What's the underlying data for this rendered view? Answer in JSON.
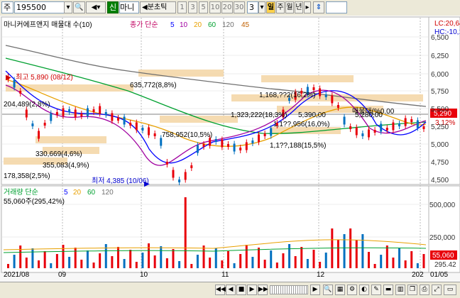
{
  "toolbar": {
    "market_label": "주",
    "code_value": "195500",
    "credit_badge": "신",
    "stock_name": "마니",
    "mode_label": "분초틱",
    "periods": [
      "1",
      "3",
      "5",
      "10",
      "20",
      "30"
    ],
    "count_value": "3",
    "scale_active": "일",
    "scales": [
      "주",
      "월",
      "년"
    ]
  },
  "chart": {
    "title": "마니커에프앤지 매물대 수(10)",
    "ma_label": "종가 단순",
    "ma_periods": [
      "5",
      "10",
      "20",
      "60",
      "120",
      "45"
    ],
    "lc": "LC:20,64",
    "hc": "HC:-10,1",
    "y_ticks": [
      "6,500",
      "6,250",
      "6,000",
      "5,750",
      "5,500",
      "5,250",
      "5,000",
      "4,750",
      "4,500"
    ],
    "last_price": "5,290",
    "change_pct": "3.12%",
    "high_note": "최고 5,890 (08/12)",
    "low_note": "최저 4,385 (10/06)",
    "current_line_label": "매물대(%0.00",
    "zones": [
      "635,772(8,8%)",
      "1,168,??2(16,2%)",
      "204,489(2,8%)",
      "1,323,222(18,3%)",
      "5,390,00",
      "5,280,00",
      "1,1??,956(16,0%)",
      "758,952(10,5%)",
      "1,1??,188(15,5%)",
      "330,669(4,6%)",
      "355,083(4,9%)",
      "178,358(2,5%)"
    ],
    "volume": {
      "title": "거래량 단순",
      "ma_periods": [
        "5",
        "20",
        "60",
        "120"
      ],
      "current": "55,060주(295,42%)",
      "y_ticks": [
        "500,000",
        "250,000"
      ],
      "last_value": "55,060",
      "last_pct": "295.42"
    },
    "x_labels": [
      "2021/08",
      "09",
      "10",
      "11",
      "12",
      "202",
      "01/05"
    ]
  },
  "colors": {
    "up": "#e8000b",
    "down": "#0070c0",
    "ma5": "#0000ff",
    "ma20": "#e8a000",
    "ma60": "#00a030",
    "ma120": "#707070",
    "zone": "#f4d7a8"
  }
}
